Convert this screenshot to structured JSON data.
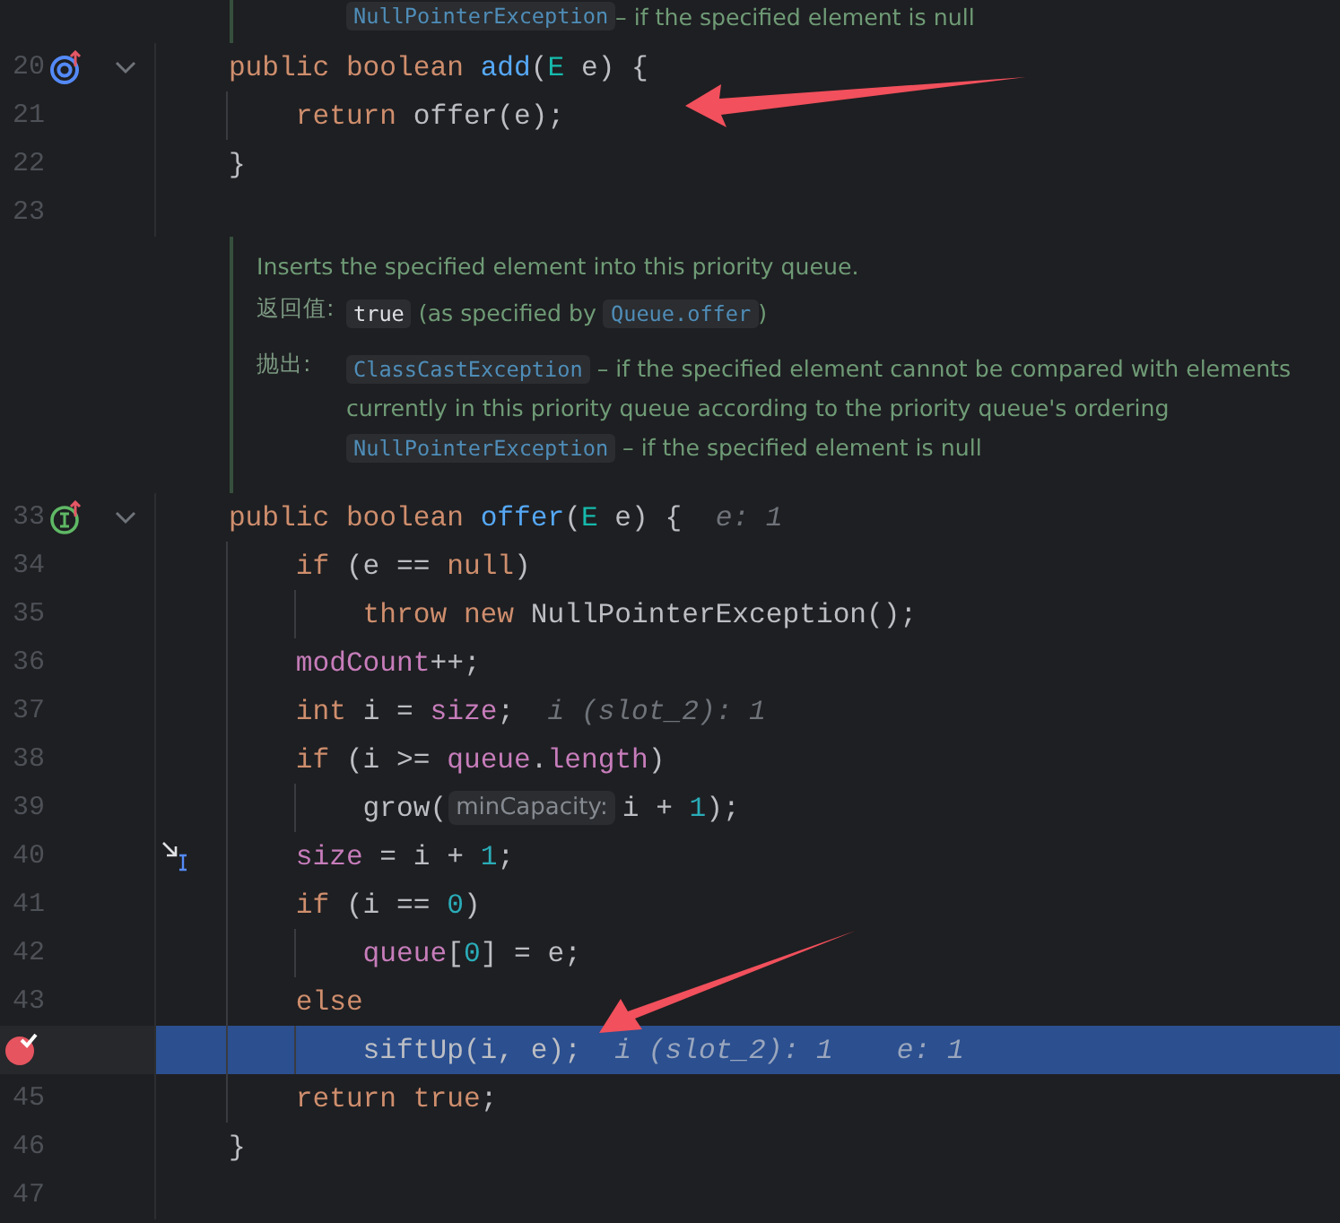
{
  "doc_tail": [
    {
      "kind": "link",
      "text": "NullPointerException"
    },
    {
      "kind": "text",
      "text": " – if the specified element is null"
    }
  ],
  "blocks": [
    {
      "kind": "line",
      "number": "20",
      "gutter_icon": {
        "kind": "overrides"
      },
      "fold": true,
      "breakpoint": false,
      "current": false,
      "tokens": [
        {
          "kind": "kw",
          "text": "    public boolean "
        },
        {
          "kind": "decl",
          "text": "add"
        },
        {
          "kind": "plain",
          "text": "("
        },
        {
          "kind": "type",
          "text": "E"
        },
        {
          "kind": "plain",
          "text": " e) {"
        }
      ]
    },
    {
      "kind": "line",
      "number": "21",
      "fold": false,
      "breakpoint": false,
      "current": false,
      "tokens": [
        {
          "kind": "kw",
          "text": "        return "
        },
        {
          "kind": "plain",
          "text": "offer(e);"
        }
      ]
    },
    {
      "kind": "line",
      "number": "22",
      "fold": false,
      "breakpoint": false,
      "current": false,
      "tokens": [
        {
          "kind": "plain",
          "text": "    }"
        }
      ]
    },
    {
      "kind": "line",
      "number": "23",
      "fold": false,
      "breakpoint": false,
      "current": false
    },
    {
      "kind": "doc",
      "summary": "Inserts the specified element into this priority queue.",
      "sections": [
        {
          "label": "返回值:",
          "paragraphs": [
            [
              {
                "kind": "literal",
                "text": "true"
              },
              {
                "kind": "text",
                "text": " (as specified by "
              },
              {
                "kind": "link",
                "text": "Queue.offer"
              },
              {
                "kind": "text",
                "text": ")"
              }
            ]
          ]
        },
        {
          "label": "抛出:",
          "paragraphs": [
            [
              {
                "kind": "link",
                "text": "ClassCastException"
              },
              {
                "kind": "text",
                "text": " – if the specified element cannot be compared with elements currently in this priority queue according to the priority queue's ordering"
              }
            ],
            [
              {
                "kind": "link",
                "text": "NullPointerException"
              },
              {
                "kind": "text",
                "text": " – if the specified element is null"
              }
            ]
          ]
        }
      ]
    },
    {
      "kind": "line",
      "number": "33",
      "gutter_icon": {
        "kind": "implements"
      },
      "fold": true,
      "breakpoint": false,
      "current": false,
      "tokens": [
        {
          "kind": "kw",
          "text": "    public boolean "
        },
        {
          "kind": "decl",
          "text": "offer"
        },
        {
          "kind": "plain",
          "text": "("
        },
        {
          "kind": "type",
          "text": "E"
        },
        {
          "kind": "plain",
          "text": " e) {"
        },
        {
          "kind": "hint",
          "text": "e: 1"
        }
      ]
    },
    {
      "kind": "line",
      "number": "34",
      "fold": false,
      "breakpoint": false,
      "current": false,
      "tokens": [
        {
          "kind": "kw",
          "text": "        if "
        },
        {
          "kind": "plain",
          "text": "(e == "
        },
        {
          "kind": "kw",
          "text": "null"
        },
        {
          "kind": "plain",
          "text": ")"
        }
      ]
    },
    {
      "kind": "line",
      "number": "35",
      "fold": false,
      "breakpoint": false,
      "current": false,
      "tokens": [
        {
          "kind": "kw",
          "text": "            throw new "
        },
        {
          "kind": "plain",
          "text": "NullPointerException();"
        }
      ]
    },
    {
      "kind": "line",
      "number": "36",
      "fold": false,
      "breakpoint": false,
      "current": false,
      "tokens": [
        {
          "kind": "field",
          "text": "        modCount"
        },
        {
          "kind": "plain",
          "text": "++;"
        }
      ]
    },
    {
      "kind": "line",
      "number": "37",
      "fold": false,
      "breakpoint": false,
      "current": false,
      "tokens": [
        {
          "kind": "kw",
          "text": "        int "
        },
        {
          "kind": "plain",
          "text": "i = "
        },
        {
          "kind": "field",
          "text": "size"
        },
        {
          "kind": "plain",
          "text": ";"
        },
        {
          "kind": "hint",
          "text": "i (slot_2): 1"
        }
      ]
    },
    {
      "kind": "line",
      "number": "38",
      "fold": false,
      "breakpoint": false,
      "current": false,
      "tokens": [
        {
          "kind": "kw",
          "text": "        if "
        },
        {
          "kind": "plain",
          "text": "(i >= "
        },
        {
          "kind": "field",
          "text": "queue"
        },
        {
          "kind": "plain",
          "text": "."
        },
        {
          "kind": "field",
          "text": "length"
        },
        {
          "kind": "plain",
          "text": ")"
        }
      ]
    },
    {
      "kind": "line",
      "number": "39",
      "fold": false,
      "breakpoint": false,
      "current": false,
      "tokens": [
        {
          "kind": "plain",
          "text": "            grow("
        },
        {
          "kind": "param",
          "text": "minCapacity:"
        },
        {
          "kind": "plain",
          "text": "i + "
        },
        {
          "kind": "num",
          "text": "1"
        },
        {
          "kind": "plain",
          "text": ");"
        }
      ]
    },
    {
      "kind": "line",
      "number": "40",
      "fold": false,
      "breakpoint": false,
      "current": false,
      "cursor": true,
      "tokens": [
        {
          "kind": "field",
          "text": "        size"
        },
        {
          "kind": "plain",
          "text": " = i + "
        },
        {
          "kind": "num",
          "text": "1"
        },
        {
          "kind": "plain",
          "text": ";"
        }
      ]
    },
    {
      "kind": "line",
      "number": "41",
      "fold": false,
      "breakpoint": false,
      "current": false,
      "tokens": [
        {
          "kind": "kw",
          "text": "        if "
        },
        {
          "kind": "plain",
          "text": "(i == "
        },
        {
          "kind": "num",
          "text": "0"
        },
        {
          "kind": "plain",
          "text": ")"
        }
      ]
    },
    {
      "kind": "line",
      "number": "42",
      "fold": false,
      "breakpoint": false,
      "current": false,
      "tokens": [
        {
          "kind": "field",
          "text": "            queue"
        },
        {
          "kind": "plain",
          "text": "["
        },
        {
          "kind": "num",
          "text": "0"
        },
        {
          "kind": "plain",
          "text": "] = e;"
        }
      ]
    },
    {
      "kind": "line",
      "number": "43",
      "fold": false,
      "breakpoint": false,
      "current": false,
      "tokens": [
        {
          "kind": "kw",
          "text": "        else"
        }
      ]
    },
    {
      "kind": "line",
      "fold": false,
      "breakpoint": true,
      "current": true,
      "tokens": [
        {
          "kind": "plain",
          "text": "            siftUp(i, e);"
        },
        {
          "kind": "hint",
          "text": "i (slot_2): 1"
        },
        {
          "kind": "hint",
          "text": "e: 1"
        }
      ]
    },
    {
      "kind": "line",
      "number": "45",
      "fold": false,
      "breakpoint": false,
      "current": false,
      "tokens": [
        {
          "kind": "kw",
          "text": "        return true"
        },
        {
          "kind": "plain",
          "text": ";"
        }
      ]
    },
    {
      "kind": "line",
      "number": "46",
      "fold": false,
      "breakpoint": false,
      "current": false,
      "tokens": [
        {
          "kind": "plain",
          "text": "    }"
        }
      ]
    },
    {
      "kind": "line",
      "number": "47",
      "fold": false,
      "breakpoint": false,
      "current": false
    }
  ]
}
